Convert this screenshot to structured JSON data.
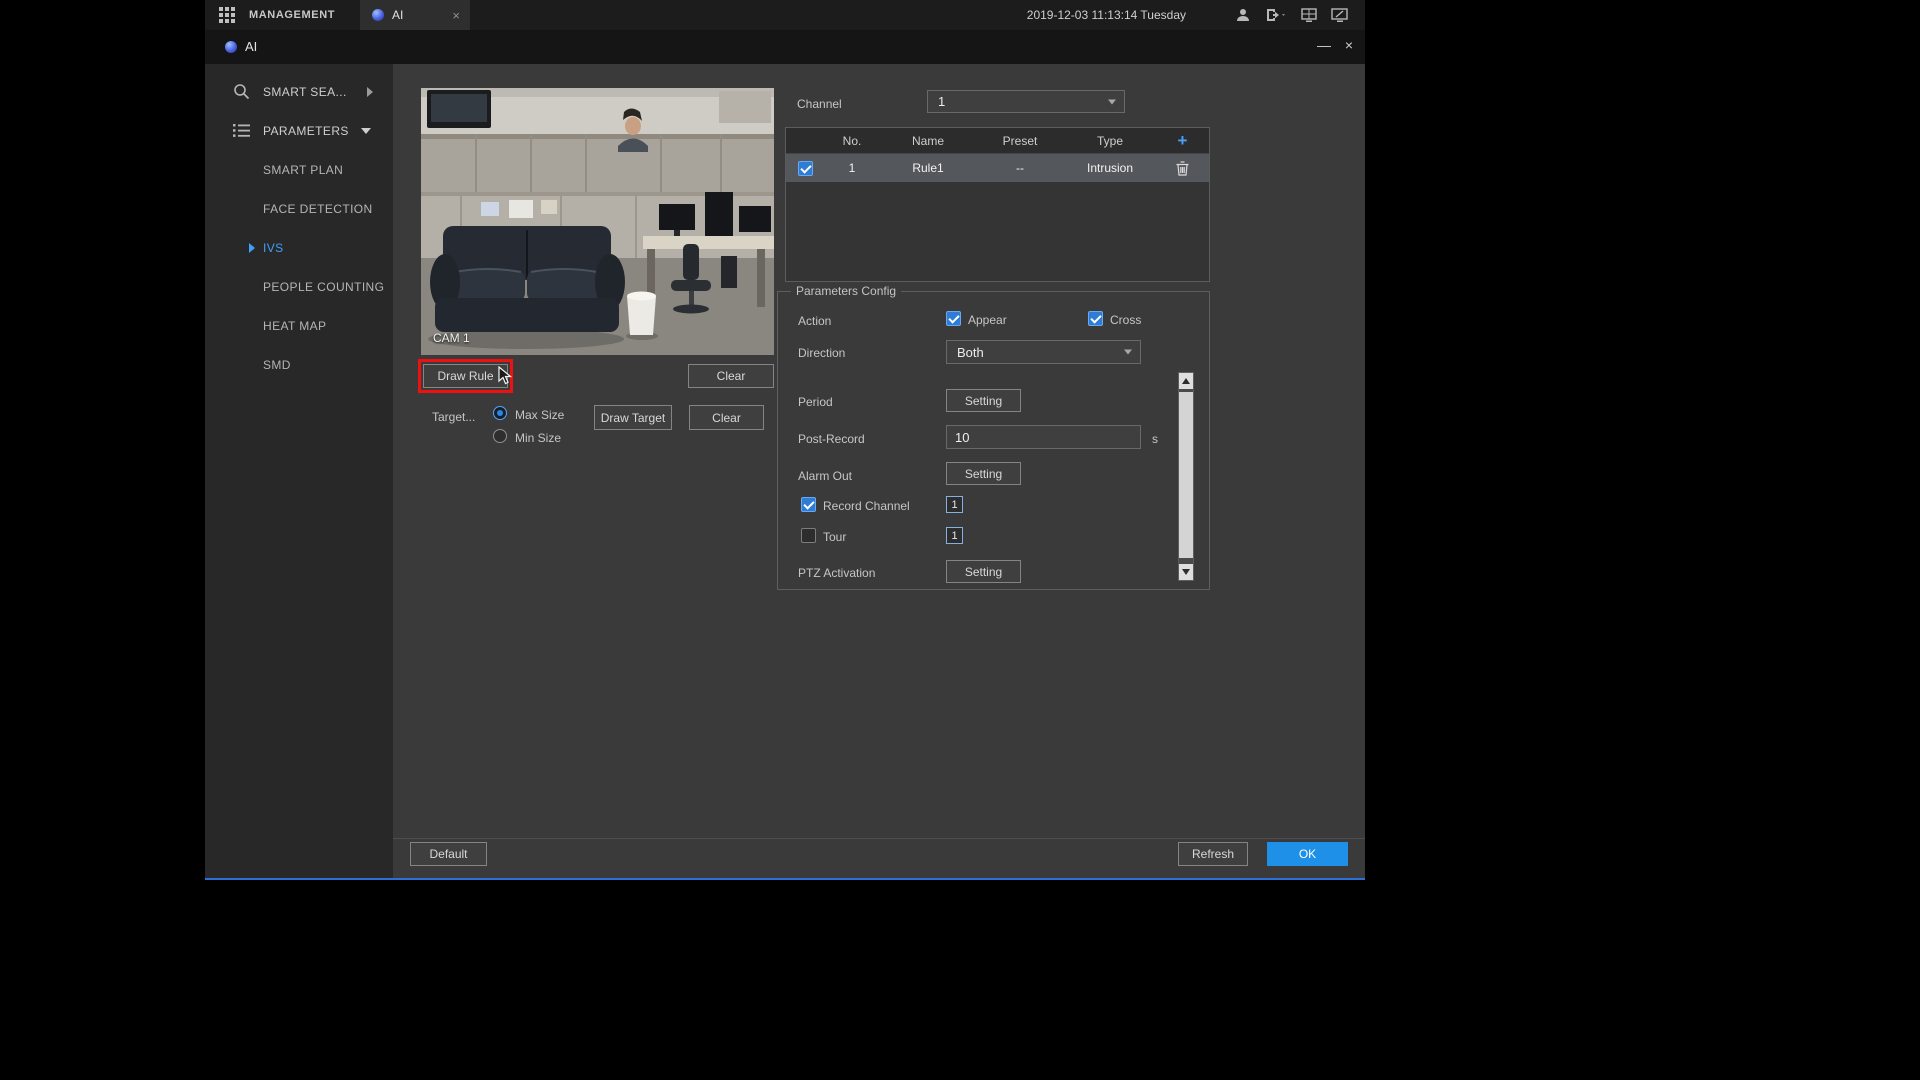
{
  "colors": {
    "accent_blue": "#3f9eff",
    "ok_button_blue": "#1e90e8",
    "highlight_red": "#ee1111",
    "checkbox_blue": "#2e7cd6"
  },
  "topbar": {
    "management": "MANAGEMENT",
    "tab": {
      "label": "AI",
      "close": "×"
    },
    "datetime": "2019-12-03 11:13:14 Tuesday"
  },
  "titlebar": {
    "title": "AI",
    "minimize": "—",
    "close": "×"
  },
  "sidebar": {
    "items": [
      {
        "label": "SMART SEA..."
      },
      {
        "label": "PARAMETERS"
      },
      {
        "label": "SMART PLAN"
      },
      {
        "label": "FACE DETECTION"
      },
      {
        "label": "IVS"
      },
      {
        "label": "PEOPLE COUNTING"
      },
      {
        "label": "HEAT MAP"
      },
      {
        "label": "SMD"
      }
    ]
  },
  "preview": {
    "camera_label": "CAM 1",
    "draw_rule": "Draw Rule",
    "clear_rule": "Clear",
    "target_label": "Target...",
    "max_size": "Max Size",
    "min_size": "Min Size",
    "draw_target": "Draw Target",
    "clear_target": "Clear"
  },
  "channel": {
    "label": "Channel",
    "value": "1"
  },
  "rules_table": {
    "headers": {
      "no": "No.",
      "name": "Name",
      "preset": "Preset",
      "type": "Type"
    },
    "add": "+",
    "row": {
      "no": "1",
      "name": "Rule1",
      "preset": "--",
      "type": "Intrusion"
    }
  },
  "params": {
    "group_title": "Parameters Config",
    "action": "Action",
    "appear": "Appear",
    "cross": "Cross",
    "direction": "Direction",
    "direction_value": "Both",
    "period": "Period",
    "period_setting": "Setting",
    "post_record": "Post-Record",
    "post_record_value": "10",
    "post_record_unit": "s",
    "alarm_out": "Alarm Out",
    "alarm_out_setting": "Setting",
    "record_channel": "Record Channel",
    "record_channel_value": "1",
    "tour": "Tour",
    "tour_value": "1",
    "ptz_activation": "PTZ Activation",
    "ptz_setting": "Setting"
  },
  "footer": {
    "default": "Default",
    "refresh": "Refresh",
    "ok": "OK"
  }
}
